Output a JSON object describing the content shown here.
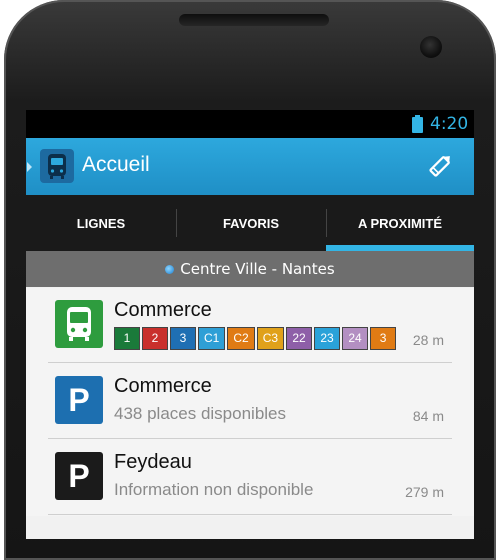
{
  "status_bar": {
    "time": "4:20"
  },
  "action_bar": {
    "title": "Accueil",
    "icons": [
      "bus-icon",
      "pencil-icon"
    ]
  },
  "tabs": [
    {
      "label": "LIGNES",
      "selected": false
    },
    {
      "label": "FAVORIS",
      "selected": false
    },
    {
      "label": "A PROXIMITÉ",
      "selected": true
    }
  ],
  "location": {
    "label": "Centre Ville - Nantes",
    "icon": "location-dot-icon"
  },
  "colors": {
    "accent": "#33b5e5",
    "action_bar": "#2196d0",
    "parking_blue": "#1d6fb0",
    "parking_dark": "#1b1b1b",
    "bus_green": "#2e9c3e"
  },
  "items": [
    {
      "type": "stop",
      "icon": "bus-icon",
      "title": "Commerce",
      "distance": "28 m",
      "lines": [
        {
          "label": "1",
          "color": "#1a7a3a"
        },
        {
          "label": "2",
          "color": "#c9302c"
        },
        {
          "label": "3",
          "color": "#1f6fb3"
        },
        {
          "label": "C1",
          "color": "#2e9fd6"
        },
        {
          "label": "C2",
          "color": "#e07b14"
        },
        {
          "label": "C3",
          "color": "#e0a11a"
        },
        {
          "label": "22",
          "color": "#8e5fa8"
        },
        {
          "label": "23",
          "color": "#2aa2d9"
        },
        {
          "label": "24",
          "color": "#b38fc2"
        },
        {
          "label": "3",
          "color": "#e07b14"
        }
      ]
    },
    {
      "type": "parking",
      "icon": "parking-icon",
      "title": "Commerce",
      "subtitle": "438 places disponibles",
      "distance": "84 m"
    },
    {
      "type": "parking",
      "icon": "parking-icon",
      "title": "Feydeau",
      "subtitle": "Information non disponible",
      "distance": "279 m"
    }
  ]
}
